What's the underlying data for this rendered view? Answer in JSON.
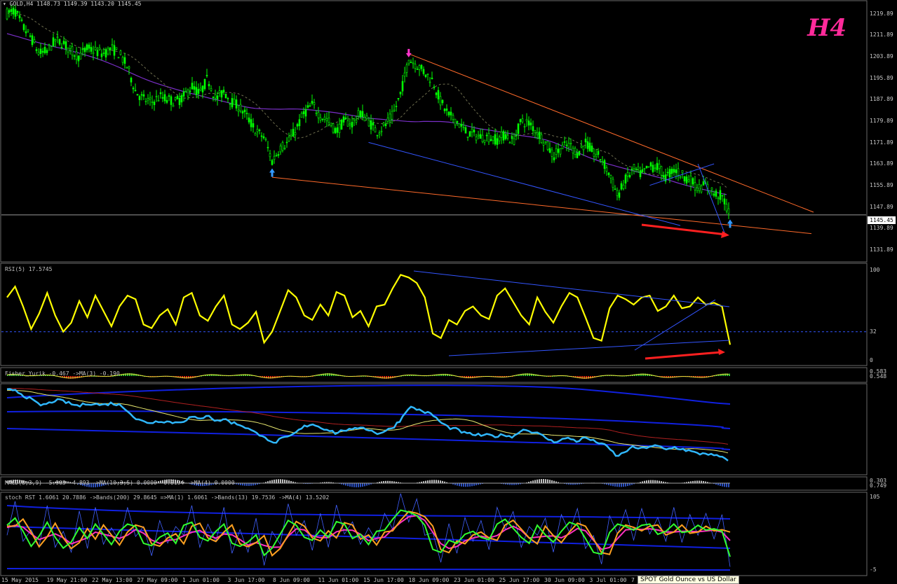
{
  "header": {
    "symbol_line": "▾ GOLD,H4  1148.73 1149.39 1143.20 1145.45"
  },
  "timeframe_badge": "H4",
  "current_price_label": "1145.45",
  "tooltip": "SPOT Gold Ounce vs US Dollar",
  "colors": {
    "background": "#000000",
    "bull_candle": "#00ff00",
    "bear_candle": "#00ff00",
    "rsi": "#ffff00",
    "trend_orange": "#ff6a2a",
    "trend_blue": "#3355ff",
    "ma_purple": "#7a2fc8",
    "signal_up": "#3399ff",
    "signal_down": "#ff33cc",
    "accent_red": "#ff2020",
    "tf_badge": "#ff2a9a"
  },
  "panes": {
    "rsi_title": "RSI(5) 17.5745",
    "fisher_title": "Fisher_Yurik -0.467  ->MA(3) -0.190",
    "macd_title": "MACD(8,3,9) -5.903 -4.893  ->MA(10,3,5) 0.0000 -0.8194  ->MA(4) 0.0000",
    "stoch_title": "stoch RST 1.6061 20.7886  ->Bands(200) 29.8645  =>MA(1) 1.6061  ->Bands(13) 19.7536  ->MA(4) 13.5202"
  },
  "price_axis_labels": [
    "1219.89",
    "1211.89",
    "1203.89",
    "1195.89",
    "1187.89",
    "1179.89",
    "1171.89",
    "1163.89",
    "1155.89",
    "1147.89",
    "1139.89",
    "1131.89"
  ],
  "rsi_axis_labels": [
    "100",
    "32",
    "0"
  ],
  "fisher_axis_labels": [
    "0.583",
    "0.548"
  ],
  "macd_axis_labels": [
    "0.303",
    "0.749"
  ],
  "stoch_axis_labels": [
    "105",
    "-5"
  ],
  "time_axis_labels": [
    "15 May 2015",
    "19 May 21:00",
    "22 May 13:00",
    "27 May 09:00",
    "1 Jun 01:00",
    "3 Jun 17:00",
    "8 Jun 09:00",
    "11 Jun 01:00",
    "15 Jun 17:00",
    "18 Jun 09:00",
    "23 Jun 01:00",
    "25 Jun 17:00",
    "30 Jun 09:00",
    "3 Jul 01:00",
    "7"
  ],
  "chart_data": [
    {
      "type": "candlestick",
      "title": "GOLD,H4",
      "ylim": [
        1128,
        1224
      ],
      "x_labels": [
        "15 May 2015",
        "19 May 21:00",
        "22 May 13:00",
        "27 May 09:00",
        "1 Jun 01:00",
        "3 Jun 17:00",
        "8 Jun 09:00",
        "11 Jun 01:00",
        "15 Jun 17:00",
        "18 Jun 09:00",
        "23 Jun 01:00",
        "25 Jun 17:00",
        "30 Jun 09:00",
        "3 Jul 01:00",
        "7"
      ],
      "close_path": [
        [
          0,
          1220
        ],
        [
          1,
          1221
        ],
        [
          2,
          1215
        ],
        [
          3,
          1211
        ],
        [
          4,
          1205
        ],
        [
          5,
          1206
        ],
        [
          6,
          1210
        ],
        [
          7,
          1209
        ],
        [
          8,
          1206
        ],
        [
          9,
          1204
        ],
        [
          10,
          1207
        ],
        [
          11,
          1206
        ],
        [
          12,
          1205
        ],
        [
          13,
          1207
        ],
        [
          14,
          1205
        ],
        [
          15,
          1200
        ],
        [
          16,
          1191
        ],
        [
          17,
          1188
        ],
        [
          18,
          1187
        ],
        [
          19,
          1189
        ],
        [
          20,
          1188
        ],
        [
          21,
          1187
        ],
        [
          22,
          1189
        ],
        [
          23,
          1193
        ],
        [
          24,
          1190
        ],
        [
          25,
          1196
        ],
        [
          26,
          1188
        ],
        [
          27,
          1191
        ],
        [
          28,
          1187
        ],
        [
          29,
          1185
        ],
        [
          30,
          1181
        ],
        [
          31,
          1176
        ],
        [
          32,
          1174
        ],
        [
          33,
          1165
        ],
        [
          34,
          1170
        ],
        [
          35,
          1172
        ],
        [
          36,
          1177
        ],
        [
          37,
          1183
        ],
        [
          38,
          1186
        ],
        [
          39,
          1182
        ],
        [
          40,
          1180
        ],
        [
          41,
          1176
        ],
        [
          42,
          1180
        ],
        [
          43,
          1179
        ],
        [
          44,
          1183
        ],
        [
          45,
          1180
        ],
        [
          46,
          1176
        ],
        [
          47,
          1178
        ],
        [
          48,
          1182
        ],
        [
          49,
          1190
        ],
        [
          50,
          1203
        ],
        [
          51,
          1201
        ],
        [
          52,
          1198
        ],
        [
          53,
          1195
        ],
        [
          54,
          1187
        ],
        [
          55,
          1182
        ],
        [
          56,
          1180
        ],
        [
          57,
          1176
        ],
        [
          58,
          1175
        ],
        [
          59,
          1174
        ],
        [
          60,
          1174
        ],
        [
          61,
          1173
        ],
        [
          62,
          1175
        ],
        [
          63,
          1172
        ],
        [
          64,
          1180
        ],
        [
          65,
          1179
        ],
        [
          66,
          1176
        ],
        [
          67,
          1172
        ],
        [
          68,
          1167
        ],
        [
          69,
          1170
        ],
        [
          70,
          1171
        ],
        [
          71,
          1168
        ],
        [
          72,
          1172
        ],
        [
          73,
          1168
        ],
        [
          74,
          1166
        ],
        [
          75,
          1160
        ],
        [
          76,
          1152
        ],
        [
          77,
          1158
        ],
        [
          78,
          1162
        ],
        [
          79,
          1160
        ],
        [
          80,
          1163
        ],
        [
          81,
          1163
        ],
        [
          82,
          1159
        ],
        [
          83,
          1162
        ],
        [
          84,
          1160
        ],
        [
          85,
          1158
        ],
        [
          86,
          1155
        ],
        [
          87,
          1156
        ],
        [
          88,
          1153
        ],
        [
          89,
          1152
        ],
        [
          90,
          1145
        ]
      ],
      "signals": [
        {
          "type": "up",
          "x_index": 33,
          "price": 1161
        },
        {
          "type": "down",
          "x_index": 50,
          "price": 1205
        },
        {
          "type": "up",
          "x_index": 90,
          "price": 1142
        }
      ]
    },
    {
      "type": "line",
      "title": "RSI(5) 17.5745",
      "ylim": [
        0,
        100
      ],
      "levels": [
        32
      ],
      "series": [
        {
          "values": [
            70,
            82,
            60,
            35,
            52,
            75,
            50,
            32,
            42,
            66,
            48,
            72,
            55,
            38,
            60,
            72,
            68,
            40,
            36,
            50,
            57,
            40,
            70,
            75,
            50,
            44,
            60,
            72,
            40,
            35,
            42,
            54,
            20,
            32,
            55,
            78,
            70,
            50,
            45,
            62,
            50,
            76,
            72,
            48,
            55,
            38,
            60,
            62,
            80,
            95,
            92,
            86,
            70,
            30,
            25,
            45,
            40,
            55,
            60,
            50,
            46,
            72,
            80,
            65,
            50,
            40,
            70,
            54,
            42,
            60,
            75,
            70,
            48,
            25,
            22,
            58,
            72,
            68,
            62,
            70,
            72,
            55,
            60,
            72,
            58,
            60,
            70,
            62,
            64,
            60,
            17.5745
          ]
        }
      ]
    }
  ]
}
